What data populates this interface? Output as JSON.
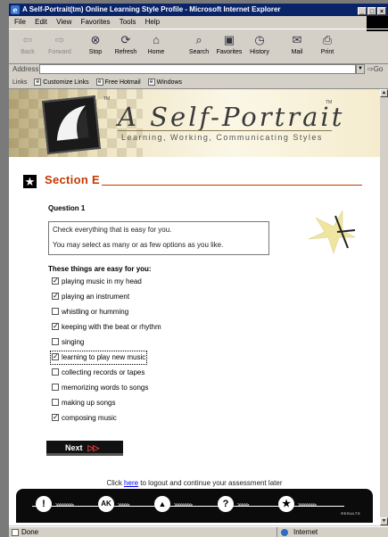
{
  "window": {
    "title": "A Self-Portrait(tm) Online Learning Style Profile - Microsoft Internet Explorer",
    "controls": [
      "_",
      "□",
      "×"
    ]
  },
  "menu": [
    "File",
    "Edit",
    "View",
    "Favorites",
    "Tools",
    "Help"
  ],
  "toolbar": [
    {
      "label": "Back",
      "icon": "back-arrow",
      "enabled": false
    },
    {
      "label": "Forward",
      "icon": "forward-arrow",
      "enabled": false
    },
    {
      "label": "Stop",
      "icon": "stop-icon",
      "enabled": true
    },
    {
      "label": "Refresh",
      "icon": "refresh-icon",
      "enabled": true
    },
    {
      "label": "Home",
      "icon": "home-icon",
      "enabled": true
    },
    {
      "label": "Search",
      "icon": "search-icon",
      "enabled": true
    },
    {
      "label": "Favorites",
      "icon": "favorites-icon",
      "enabled": true
    },
    {
      "label": "History",
      "icon": "history-icon",
      "enabled": true
    },
    {
      "label": "Mail",
      "icon": "mail-icon",
      "enabled": true
    },
    {
      "label": "Print",
      "icon": "print-icon",
      "enabled": true
    }
  ],
  "address": {
    "label": "Address",
    "value": "",
    "go_label": "Go"
  },
  "links": {
    "label": "Links",
    "items": [
      "Customize Links",
      "Free Hotmail",
      "Windows"
    ]
  },
  "banner": {
    "brand": "A Self-Portrait",
    "trademark": "TM",
    "subtitle": "Learning, Working, Communicating Styles"
  },
  "section": {
    "title": "Section E"
  },
  "question": {
    "label": "Question 1",
    "instructions": [
      "Check everything that is easy for you.",
      "You may select as many or as few options as you like."
    ],
    "heading": "These things are easy for you:",
    "options": [
      {
        "label": "playing music in my head",
        "checked": true
      },
      {
        "label": "playing an instrument",
        "checked": true
      },
      {
        "label": "whistling or humming",
        "checked": false
      },
      {
        "label": "keeping with the beat or rhythm",
        "checked": true
      },
      {
        "label": "singing",
        "checked": false
      },
      {
        "label": "learning to play new music",
        "checked": true
      },
      {
        "label": "collecting records or tapes",
        "checked": false
      },
      {
        "label": "memorizing words to songs",
        "checked": false
      },
      {
        "label": "making up songs",
        "checked": false
      },
      {
        "label": "composing music",
        "checked": true
      }
    ]
  },
  "next_button": {
    "label": "Next",
    "arrows": "▷▷"
  },
  "logout": {
    "before": "Click ",
    "link": "here",
    "after": " to logout and continue your assessment later"
  },
  "progress": {
    "nodes": [
      "!",
      "AK",
      "▲",
      "?",
      "★"
    ],
    "end_label": "RESULTS"
  },
  "status": {
    "left": "Done",
    "zone": "Internet"
  },
  "colors": {
    "section_accent": "#c33a00",
    "titlebar": "#0a246a"
  }
}
